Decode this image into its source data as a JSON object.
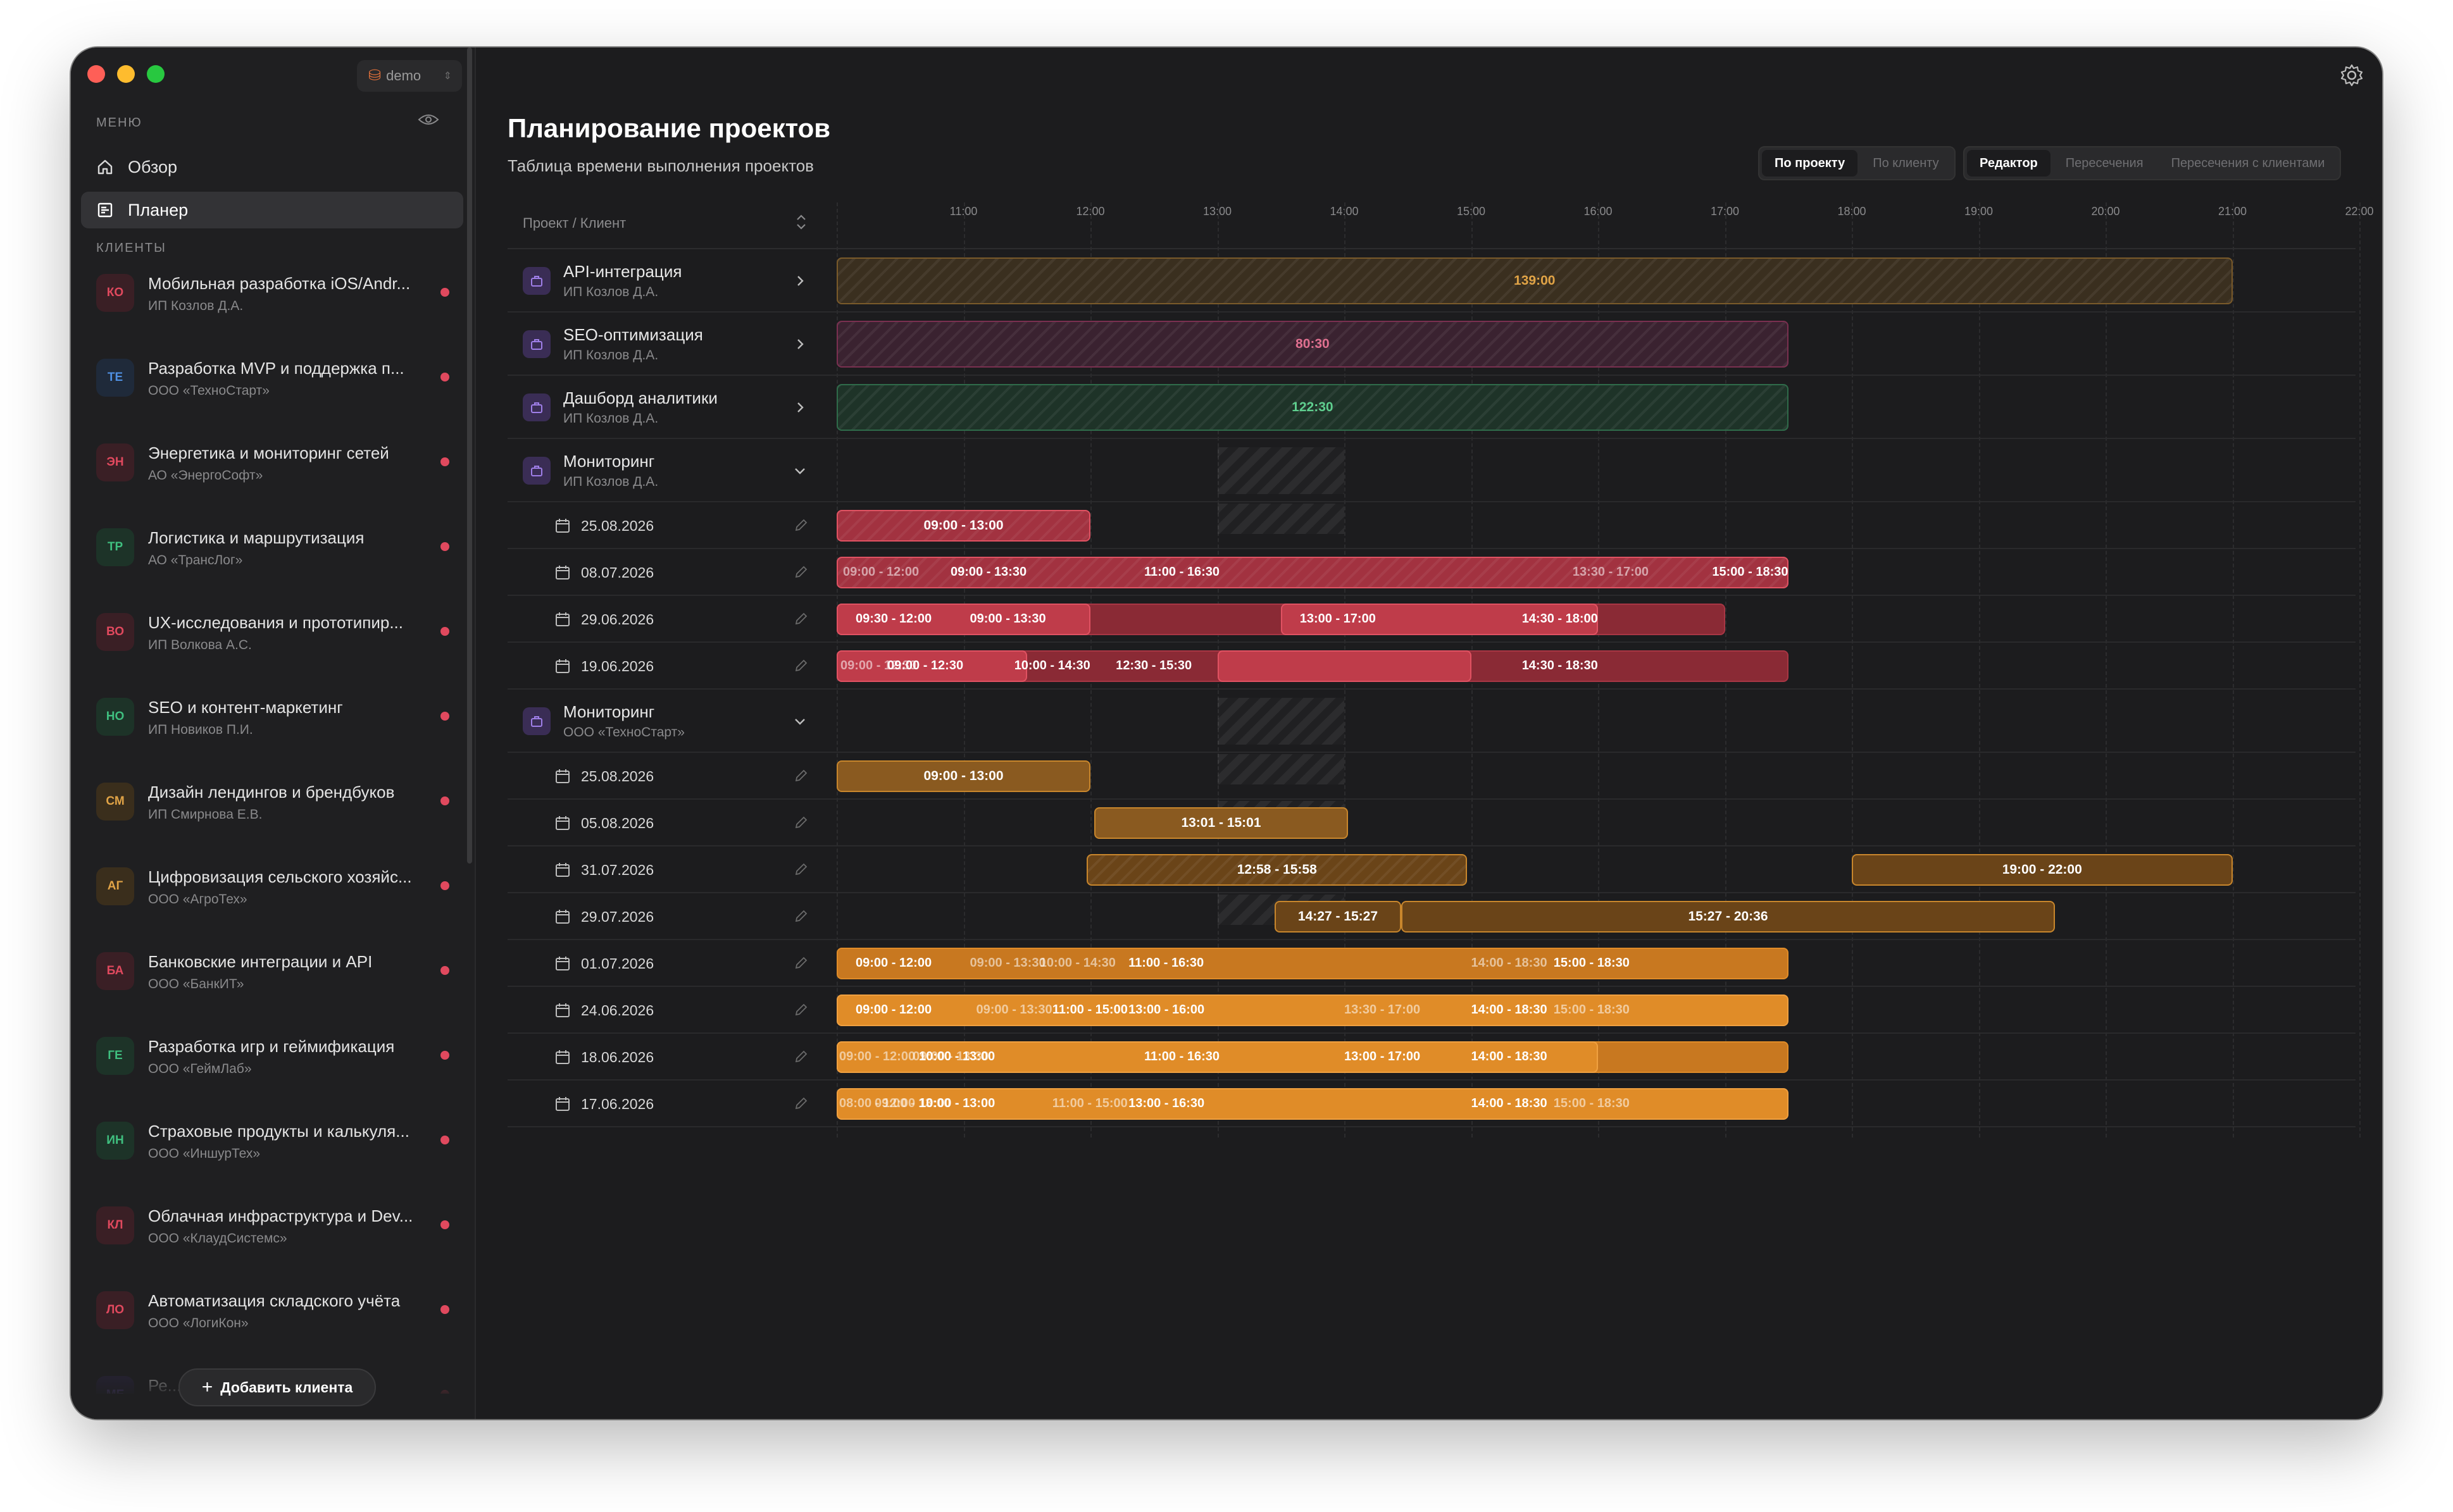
{
  "workspace": {
    "name": "demo"
  },
  "sidebar": {
    "menu_title": "МЕНЮ",
    "nav": [
      {
        "label": "Обзор",
        "icon": "home-icon"
      },
      {
        "label": "Планер",
        "icon": "planner-icon",
        "active": true
      }
    ],
    "clients_title": "КЛИЕНТЫ",
    "clients": [
      {
        "initials": "КО",
        "name": "Мобильная разработка iOS/Andr...",
        "owner": "ИП Козлов Д.А.",
        "color": "#e0495e",
        "bg": "#3a1f25"
      },
      {
        "initials": "ТЕ",
        "name": "Разработка MVP и поддержка п...",
        "owner": "ООО «ТехноСтарт»",
        "color": "#4f8fe0",
        "bg": "#1f2a3a"
      },
      {
        "initials": "ЭН",
        "name": "Энергетика и мониторинг сетей",
        "owner": "АО «ЭнергоСофт»",
        "color": "#e0495e",
        "bg": "#3a1f25"
      },
      {
        "initials": "ТР",
        "name": "Логистика и маршрутизация",
        "owner": "АО «ТрансЛог»",
        "color": "#3fbf7f",
        "bg": "#1d3328"
      },
      {
        "initials": "ВО",
        "name": "UX-исследования и прототипир...",
        "owner": "ИП Волкова А.С.",
        "color": "#e0495e",
        "bg": "#3a1f25"
      },
      {
        "initials": "НО",
        "name": "SEO и контент-маркетинг",
        "owner": "ИП Новиков П.И.",
        "color": "#3fbf7f",
        "bg": "#1d3328"
      },
      {
        "initials": "СМ",
        "name": "Дизайн лендингов и брендбуков",
        "owner": "ИП Смирнова Е.В.",
        "color": "#e0a346",
        "bg": "#3a2e1c"
      },
      {
        "initials": "АГ",
        "name": "Цифровизация сельского хозяйс...",
        "owner": "ООО «АгроТех»",
        "color": "#e0a346",
        "bg": "#3a2e1c"
      },
      {
        "initials": "БА",
        "name": "Банковские интеграции и API",
        "owner": "ООО «БанкИТ»",
        "color": "#e0495e",
        "bg": "#3a1f25"
      },
      {
        "initials": "ГЕ",
        "name": "Разработка игр и геймификация",
        "owner": "ООО «ГеймЛаб»",
        "color": "#3fbf7f",
        "bg": "#1d3328"
      },
      {
        "initials": "ИН",
        "name": "Страховые продукты и калькуля...",
        "owner": "ООО «ИншурТех»",
        "color": "#3fbf7f",
        "bg": "#1d3328"
      },
      {
        "initials": "КЛ",
        "name": "Облачная инфраструктура и Dev...",
        "owner": "ООО «КлаудСистемс»",
        "color": "#e0495e",
        "bg": "#3a1f25"
      },
      {
        "initials": "ЛО",
        "name": "Автоматизация складского учёта",
        "owner": "ООО «ЛогиКон»",
        "color": "#e0495e",
        "bg": "#3a1f25"
      },
      {
        "initials": "МЕ",
        "name": "Ре...",
        "owner": "",
        "color": "#7a5fd0",
        "bg": "#2a2440"
      }
    ],
    "add_client": "Добавить клиента"
  },
  "main": {
    "title": "Планирование проектов",
    "subtitle": "Таблица времени выполнения проектов",
    "view_toggle": [
      "По проекту",
      "По клиенту"
    ],
    "mode_toggle": [
      "Редактор",
      "Пересечения",
      "Пересечения с клиентами"
    ],
    "column_header": "Проект / Клиент",
    "hours": [
      "11:00",
      "12:00",
      "13:00",
      "14:00",
      "15:00",
      "16:00",
      "17:00",
      "18:00",
      "19:00",
      "20:00",
      "21:00",
      "22:00"
    ],
    "projects": [
      {
        "name": "API-интеграция",
        "client": "ИП Козлов Д.А.",
        "total": "139:00"
      },
      {
        "name": "SEO-оптимизация",
        "client": "ИП Козлов Д.А.",
        "total": "80:30"
      },
      {
        "name": "Дашборд аналитики",
        "client": "ИП Козлов Д.А.",
        "total": "122:30"
      },
      {
        "name": "Мониторинг",
        "client": "ИП Козлов Д.А."
      },
      {
        "name": "Мониторинг",
        "client": "ООО «ТехноСтарт»"
      }
    ],
    "dates_a": [
      "25.08.2026",
      "08.07.2026",
      "29.06.2026",
      "19.06.2026"
    ],
    "dates_b": [
      "25.08.2026",
      "05.08.2026",
      "31.07.2026",
      "29.07.2026",
      "01.07.2026",
      "24.06.2026",
      "18.06.2026",
      "17.06.2026"
    ],
    "labels": {
      "a0": "09:00 - 13:00",
      "a1": [
        "09:00 - 12:00",
        "09:00 - 13:30",
        "11:00 - 16:30",
        "13:30 - 17:00",
        "15:00 - 18:30"
      ],
      "a2": [
        "09:30 - 12:00",
        "09:00 - 13:30",
        "13:00 - 17:00",
        "14:30 - 18:00"
      ],
      "a3": [
        "09:00 - 12:30",
        "09:00 - 12:30",
        "10:00 - 14:30",
        "12:30 - 15:30",
        "14:30 - 18:30"
      ],
      "b0": "09:00 - 13:00",
      "b1": "13:01 - 15:01",
      "b2": [
        "12:58 - 15:58",
        "19:00 - 22:00"
      ],
      "b3": [
        "14:27 - 15:27",
        "15:27 - 20:36"
      ],
      "b4": [
        "09:00 - 12:00",
        "09:00 - 13:30",
        "10:00 - 14:30",
        "11:00 - 16:30",
        "14:00 - 18:30",
        "15:00 - 18:30"
      ],
      "b5": [
        "09:00 - 12:00",
        "09:00 - 13:30",
        "11:00 - 15:00",
        "13:00 - 16:00",
        "13:30 - 17:00",
        "14:00 - 18:30",
        "15:00 - 18:30"
      ],
      "b6": [
        "09:00 - 12:00",
        "10:00 - 13:00",
        "09:00 - 13:30",
        "11:00 - 16:30",
        "13:00 - 17:00",
        "14:00 - 18:30"
      ],
      "b7": [
        "08:00 - 12:00",
        "09:00 - 13:00",
        "10:00 - 13:00",
        "11:00 - 15:00",
        "13:00 - 16:30",
        "14:00 - 18:30",
        "15:00 - 18:30"
      ]
    }
  },
  "colors": {
    "red": "#e05262",
    "orange": "#e08c28",
    "brown": "#8a5a20",
    "gold": "#e0a346",
    "pink": "#e07090",
    "green": "#5fcf8f"
  }
}
